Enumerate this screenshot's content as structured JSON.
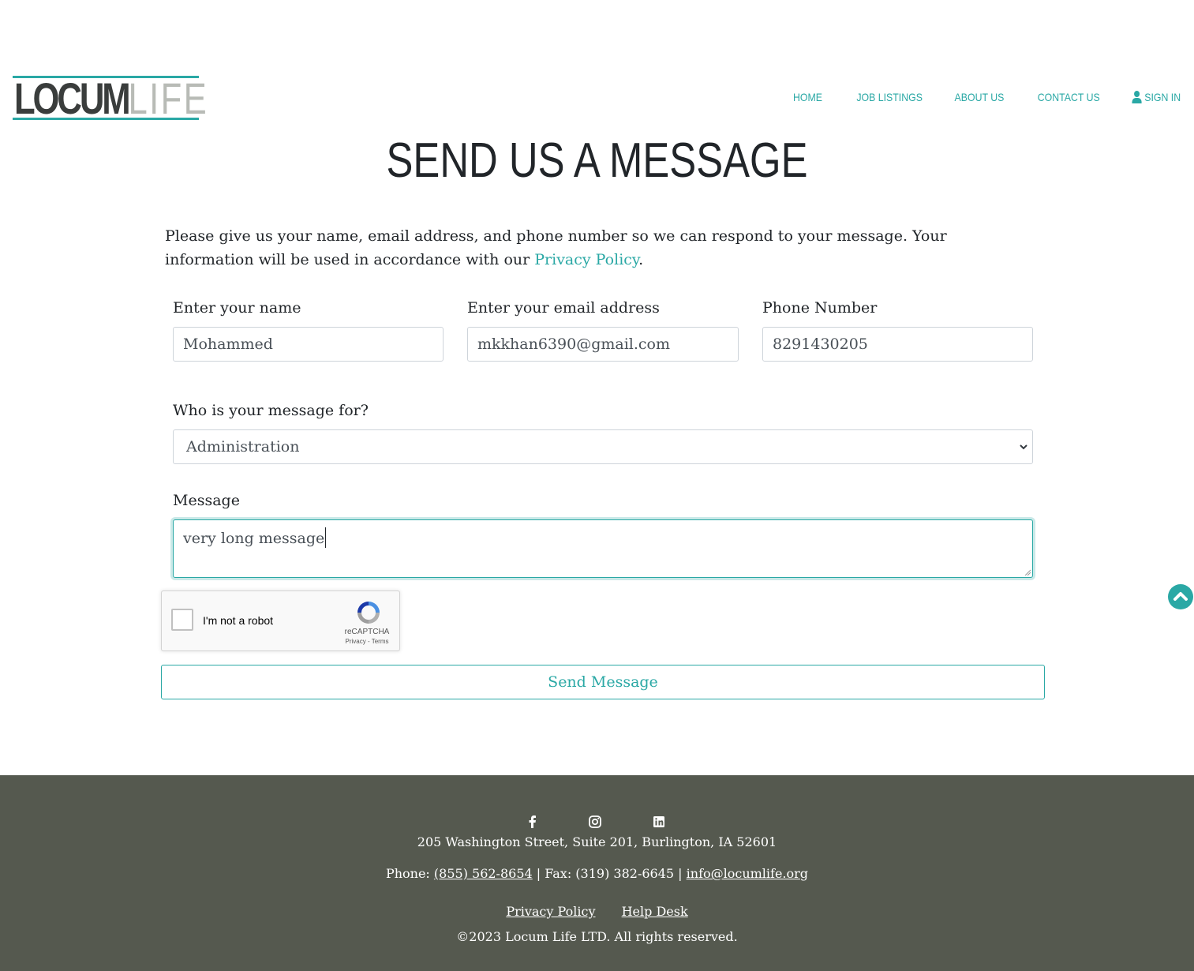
{
  "header": {
    "logo_text": "LOCUMLIFE",
    "logo_part1": "LOCUM",
    "logo_part2": "LIFE",
    "nav": {
      "home": "HOME",
      "job_listings": "JOB LISTINGS",
      "about_us": "ABOUT US",
      "contact_us": "CONTACT US",
      "sign_in": "SIGN IN"
    }
  },
  "page": {
    "title": "SEND US A MESSAGE",
    "intro_text": "Please give us your name, email address, and phone number so we can respond to your message. Your information will be used in accordance with our ",
    "intro_link": "Privacy Policy",
    "intro_end": "."
  },
  "form": {
    "name_label": "Enter your name",
    "name_value": "Mohammed",
    "email_label": "Enter your email address",
    "email_value": "mkkhan6390@gmail.com",
    "phone_label": "Phone Number",
    "phone_value": "8291430205",
    "recipient_label": "Who is your message for?",
    "recipient_value": "Administration",
    "message_label": "Message",
    "message_value": "very long message",
    "captcha_label": "I'm not a robot",
    "captcha_brand": "reCAPTCHA",
    "captcha_links": "Privacy - Terms",
    "submit_label": "Send Message"
  },
  "footer": {
    "address": "205 Washington Street, Suite 201, Burlington, IA 52601",
    "phone_prefix": "Phone: ",
    "phone": "(855) 562-8654",
    "fax_text": " | Fax: (319) 382-6645 | ",
    "email": "info@locumlife.org",
    "privacy_link": "Privacy Policy",
    "helpdesk_link": "Help Desk",
    "copyright": "©2023 Locum Life LTD. All rights reserved.",
    "social_icons": [
      "facebook-icon",
      "instagram-icon",
      "linkedin-icon"
    ]
  },
  "colors": {
    "accent": "#2aa8a5",
    "footer_bg": "#55594f",
    "logo_dark": "#3a3d3c",
    "logo_light": "#b8bbb6"
  }
}
